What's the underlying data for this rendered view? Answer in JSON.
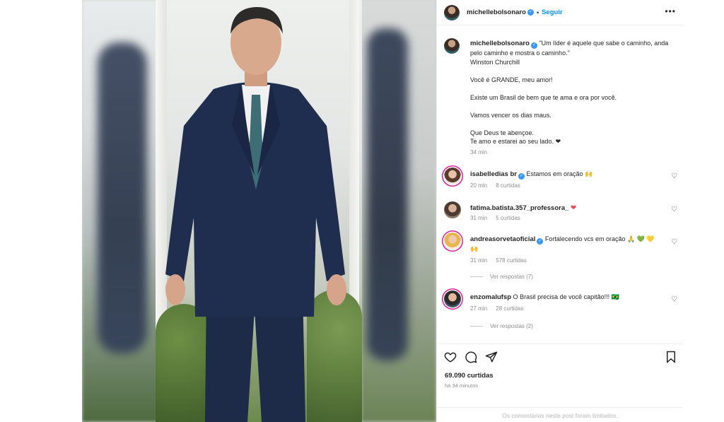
{
  "post": {
    "author": "michellebolsonaro",
    "follow_label": "Seguir",
    "caption_lines": [
      "\"Um líder é aquele que sabe o caminho, anda pelo caminho e mostra o caminho.\"",
      "Winston Churchill",
      "Você é GRANDE, meu amor!",
      "Existe um Brasil de bem que te ama e ora por você.",
      "Vamos vencer os dias maus.",
      "Que Deus te abençoe.",
      "Te amo e estarei ao seu lado. ❤"
    ],
    "caption_time": "34 min"
  },
  "comments": [
    {
      "user": "isabelledias br",
      "user_display": "isabelledias br",
      "text": "Estamos em oração 🙌",
      "time": "20 min",
      "likes": "8 curtidas",
      "verified": true,
      "replies": ""
    },
    {
      "user": "fatima.batista.357_professora_",
      "text": "❤",
      "time": "31 min",
      "likes": "5 curtidas",
      "verified": false,
      "replies": ""
    },
    {
      "user": "andreasorvetaoficial",
      "text": "Fortalecendo vcs em oração 🙏 💚 💛 🙌",
      "time": "31 min",
      "likes": "578 curtidas",
      "verified": true,
      "replies": "Ver respostas (7)"
    },
    {
      "user": "enzomalufsp",
      "text": "O Brasil precisa de você capitão!!! 🇧🇷",
      "time": "27 min",
      "likes": "28 curtidas",
      "verified": false,
      "replies": "Ver respostas (2)"
    }
  ],
  "footer": {
    "likes": "69.090 curtidas",
    "when": "há 34 minutos",
    "limited": "Os comentários neste post foram limitados."
  },
  "colors": {
    "link": "#0095f6",
    "heart": "#ed4956",
    "muted": "#8e8e8e",
    "verified": "#3897f0"
  },
  "icons": [
    "more-options-icon",
    "like-icon",
    "comment-icon",
    "share-icon",
    "save-icon",
    "verified-icon",
    "heart-icon"
  ]
}
